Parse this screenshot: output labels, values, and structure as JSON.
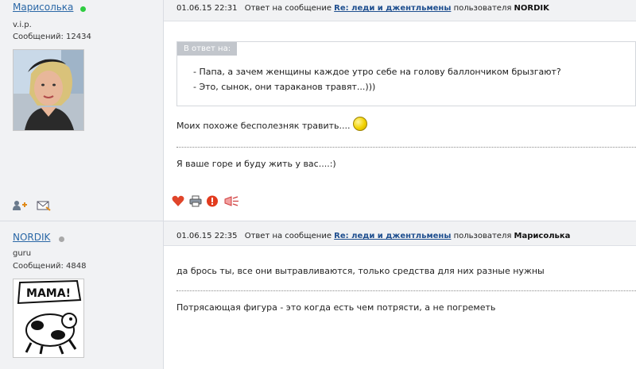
{
  "posts": [
    {
      "user": {
        "name": "Марисолька",
        "status_color": "#2ecc40",
        "rank": "v.i.p.",
        "messages": "Сообщений: 12434"
      },
      "header": {
        "date": "01.06.15 22:31",
        "reply_prefix": "Ответ на сообщение",
        "topic": "Re: леди и джентльмены",
        "by_label": "пользователя",
        "author": "NORDIK"
      },
      "quote": {
        "label": "В ответ на:",
        "lines": [
          "- Папа, а зачем женщины каждое утро себе на голову баллончиком брызгают?",
          "- Это, сынок, они тараканов травят...)))"
        ]
      },
      "body": "Моих похоже бесполезняк травить....",
      "signature": "Я ваше горе и буду жить у вас....:)"
    },
    {
      "user": {
        "name": "NORDIK",
        "status_color": "#a8a8a8",
        "rank": "guru",
        "messages": "Сообщений: 4848",
        "avatar_text": "MAMA!"
      },
      "header": {
        "date": "01.06.15 22:35",
        "reply_prefix": "Ответ на сообщение",
        "topic": "Re: леди и джентльмены",
        "by_label": "пользователя",
        "author": "Марисолька"
      },
      "body": "да брось ты, все они вытравливаются, только средства для них разные нужны",
      "signature": "Потрясающая фигура - это когда есть чем потрясти, а не погреметь"
    }
  ],
  "icons": {
    "user_actions": [
      "add-friend-icon",
      "send-message-icon"
    ],
    "post_actions": [
      "heart-icon",
      "print-icon",
      "report-icon",
      "megaphone-icon"
    ]
  }
}
